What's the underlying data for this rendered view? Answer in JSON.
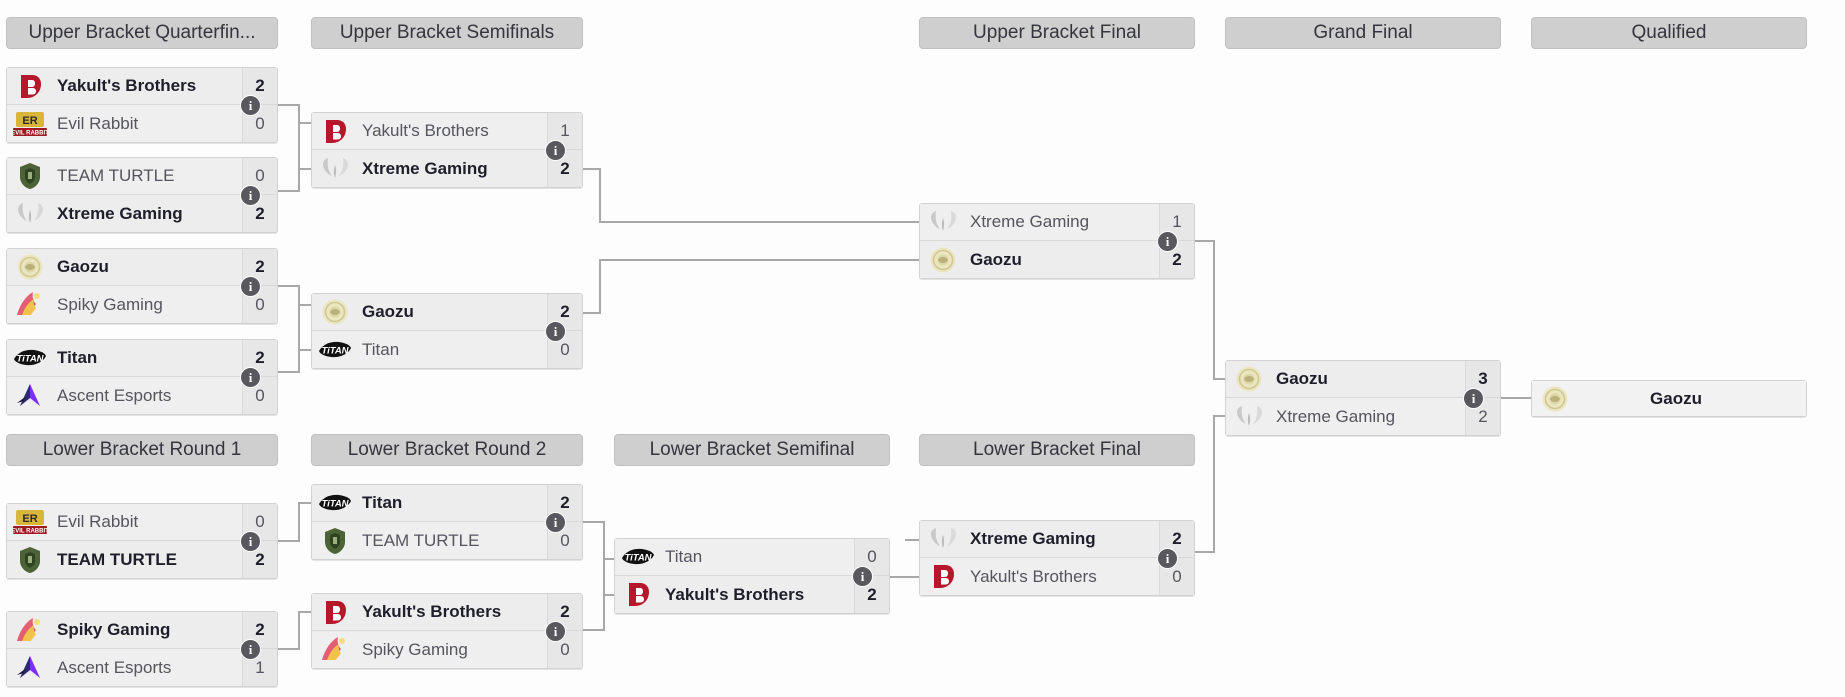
{
  "page": {
    "title": "Tournament Double Elimination Bracket",
    "info_glyph": "i",
    "colors": {
      "header_bg": "#cfcfcf",
      "match_bg": "#efefef",
      "score_bg": "#e7e7e7",
      "line": "#a8a8a8",
      "info_badge": "#58585e"
    }
  },
  "headers": {
    "ub_qf": "Upper Bracket Quarterfin...",
    "ub_sf": "Upper Bracket Semifinals",
    "ub_f": "Upper Bracket Final",
    "gf": "Grand Final",
    "qualified": "Qualified",
    "lb_r1": "Lower Bracket Round 1",
    "lb_r2": "Lower Bracket Round 2",
    "lb_sf": "Lower Bracket Semifinal",
    "lb_f": "Lower Bracket Final"
  },
  "matches": {
    "ubqf1": {
      "top": {
        "team": "Yakult's Brothers",
        "score": "2",
        "logo": "yakults-brothers-logo",
        "winner": true
      },
      "bottom": {
        "team": "Evil Rabbit",
        "score": "0",
        "logo": "evil-rabbit-logo",
        "winner": false
      }
    },
    "ubqf2": {
      "top": {
        "team": "TEAM TURTLE",
        "score": "0",
        "logo": "team-turtle-logo",
        "winner": false
      },
      "bottom": {
        "team": "Xtreme Gaming",
        "score": "2",
        "logo": "xtreme-gaming-logo",
        "winner": true
      }
    },
    "ubqf3": {
      "top": {
        "team": "Gaozu",
        "score": "2",
        "logo": "gaozu-logo",
        "winner": true
      },
      "bottom": {
        "team": "Spiky Gaming",
        "score": "0",
        "logo": "spiky-gaming-logo",
        "winner": false
      }
    },
    "ubqf4": {
      "top": {
        "team": "Titan",
        "score": "2",
        "logo": "titan-logo",
        "winner": true
      },
      "bottom": {
        "team": "Ascent Esports",
        "score": "0",
        "logo": "ascent-esports-logo",
        "winner": false
      }
    },
    "ubsf1": {
      "top": {
        "team": "Yakult's Brothers",
        "score": "1",
        "logo": "yakults-brothers-logo",
        "winner": false
      },
      "bottom": {
        "team": "Xtreme Gaming",
        "score": "2",
        "logo": "xtreme-gaming-logo",
        "winner": true
      }
    },
    "ubsf2": {
      "top": {
        "team": "Gaozu",
        "score": "2",
        "logo": "gaozu-logo",
        "winner": true
      },
      "bottom": {
        "team": "Titan",
        "score": "0",
        "logo": "titan-logo",
        "winner": false
      }
    },
    "ubf": {
      "top": {
        "team": "Xtreme Gaming",
        "score": "1",
        "logo": "xtreme-gaming-logo",
        "winner": false
      },
      "bottom": {
        "team": "Gaozu",
        "score": "2",
        "logo": "gaozu-logo",
        "winner": true
      }
    },
    "gf": {
      "top": {
        "team": "Gaozu",
        "score": "3",
        "logo": "gaozu-logo",
        "winner": true
      },
      "bottom": {
        "team": "Xtreme Gaming",
        "score": "2",
        "logo": "xtreme-gaming-logo",
        "winner": false
      }
    },
    "qualified": {
      "top": {
        "team": "Gaozu",
        "logo": "gaozu-logo",
        "winner": true
      }
    },
    "lbr1a": {
      "top": {
        "team": "Evil Rabbit",
        "score": "0",
        "logo": "evil-rabbit-logo",
        "winner": false
      },
      "bottom": {
        "team": "TEAM TURTLE",
        "score": "2",
        "logo": "team-turtle-logo",
        "winner": true
      }
    },
    "lbr1b": {
      "top": {
        "team": "Spiky Gaming",
        "score": "2",
        "logo": "spiky-gaming-logo",
        "winner": true
      },
      "bottom": {
        "team": "Ascent Esports",
        "score": "1",
        "logo": "ascent-esports-logo",
        "winner": false
      }
    },
    "lbr2a": {
      "top": {
        "team": "Titan",
        "score": "2",
        "logo": "titan-logo",
        "winner": true
      },
      "bottom": {
        "team": "TEAM TURTLE",
        "score": "0",
        "logo": "team-turtle-logo",
        "winner": false
      }
    },
    "lbr2b": {
      "top": {
        "team": "Yakult's Brothers",
        "score": "2",
        "logo": "yakults-brothers-logo",
        "winner": true
      },
      "bottom": {
        "team": "Spiky Gaming",
        "score": "0",
        "logo": "spiky-gaming-logo",
        "winner": false
      }
    },
    "lbsf": {
      "top": {
        "team": "Titan",
        "score": "0",
        "logo": "titan-logo",
        "winner": false
      },
      "bottom": {
        "team": "Yakult's Brothers",
        "score": "2",
        "logo": "yakults-brothers-logo",
        "winner": true
      }
    },
    "lbf": {
      "top": {
        "team": "Xtreme Gaming",
        "score": "2",
        "logo": "xtreme-gaming-logo",
        "winner": true
      },
      "bottom": {
        "team": "Yakult's Brothers",
        "score": "0",
        "logo": "yakults-brothers-logo",
        "winner": false
      }
    }
  }
}
